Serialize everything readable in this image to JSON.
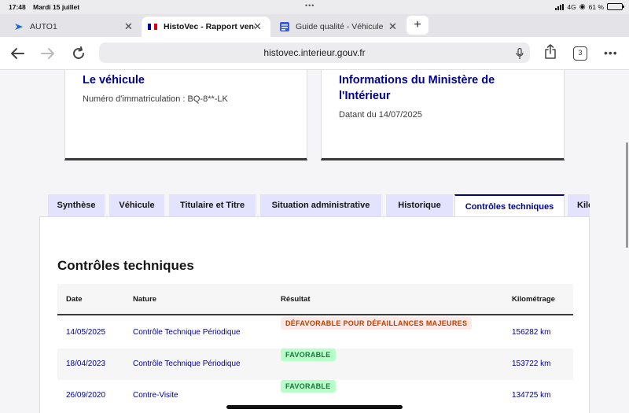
{
  "status_bar": {
    "time": "17:48",
    "date": "Mardi 15 juillet",
    "network": "4G",
    "battery": "61 %"
  },
  "browser_tabs": [
    {
      "title": "AUTO1",
      "active": false
    },
    {
      "title": "HistoVec - Rapport vendeur",
      "active": true
    },
    {
      "title": "Guide qualité - Véhicule",
      "active": false
    }
  ],
  "toolbar": {
    "url": "histovec.interieur.gouv.fr",
    "tab_count": "3"
  },
  "vehicle_card": {
    "title": "Le véhicule",
    "subtitle": "Numéro d'immatriculation : BQ-8**-LK"
  },
  "ministry_card": {
    "title": "Informations du Ministère de l'Intérieur",
    "subtitle": "Datant du 14/07/2025"
  },
  "report_tabs": [
    "Synthèse",
    "Véhicule",
    "Titulaire et Titre",
    "Situation administrative",
    "Historique",
    "Contrôles techniques",
    "Kilométrage"
  ],
  "inspections": {
    "heading": "Contrôles techniques",
    "columns": [
      "Date",
      "Nature",
      "Résultat",
      "Kilométrage"
    ],
    "rows": [
      {
        "date": "14/05/2025",
        "nature": "Contrôle Technique Périodique",
        "result": "DÉFAVORABLE POUR DÉFAILLANCES MAJEURES",
        "result_status": "bad",
        "mileage": "156282 km"
      },
      {
        "date": "18/04/2023",
        "nature": "Contrôle Technique Périodique",
        "result": "FAVORABLE",
        "result_status": "good",
        "mileage": "153722 km"
      },
      {
        "date": "26/09/2020",
        "nature": "Contre-Visite",
        "result": "FAVORABLE",
        "result_status": "good",
        "mileage": "134725 km"
      }
    ]
  },
  "colors": {
    "accent_blue": "#000091",
    "tab_inactive_bg": "#e3e3fd",
    "badge_bad_bg": "#ffe9e6",
    "badge_good_bg": "#b8fec9"
  }
}
